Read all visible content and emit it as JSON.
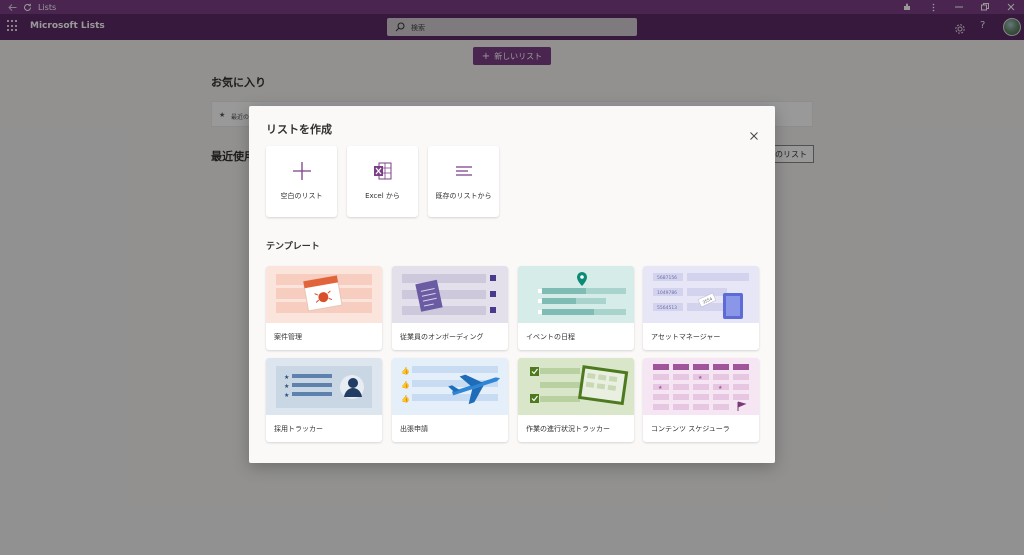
{
  "browser": {
    "title": "Lists"
  },
  "app": {
    "name": "Microsoft Lists",
    "search_placeholder": "検索"
  },
  "page": {
    "new_list_label": "新しいリスト",
    "favorites_title": "お気に入り",
    "favorites_hint": "最近の",
    "recent_title": "最近使用",
    "recent_button": "のリスト"
  },
  "modal": {
    "title": "リストを作成",
    "create_options": [
      {
        "label": "空白のリスト",
        "icon": "plus-icon"
      },
      {
        "label": "Excel から",
        "icon": "excel-icon"
      },
      {
        "label": "既存のリストから",
        "icon": "existing-list-icon"
      }
    ],
    "templates_title": "テンプレート",
    "templates": [
      {
        "name": "案件管理",
        "bg": "#fbe4dc"
      },
      {
        "name": "従業員のオンボーディング",
        "bg": "#e3e0ec"
      },
      {
        "name": "イベントの日程",
        "bg": "#d6ece9"
      },
      {
        "name": "アセットマネージャー",
        "bg": "#e6e6f6"
      },
      {
        "name": "採用トラッカー",
        "bg": "#dde6ef"
      },
      {
        "name": "出張申請",
        "bg": "#e4effa"
      },
      {
        "name": "作業の進行状況トラッカー",
        "bg": "#d9e6c9"
      },
      {
        "name": "コンテンツ スケジューラ",
        "bg": "#f6e6f3"
      }
    ],
    "asset_numbers": [
      "5687156",
      "1049786",
      "5564513"
    ],
    "asset_tag": "3554"
  },
  "colors": {
    "brand": "#7b3f86",
    "header": "#5d2b66"
  }
}
